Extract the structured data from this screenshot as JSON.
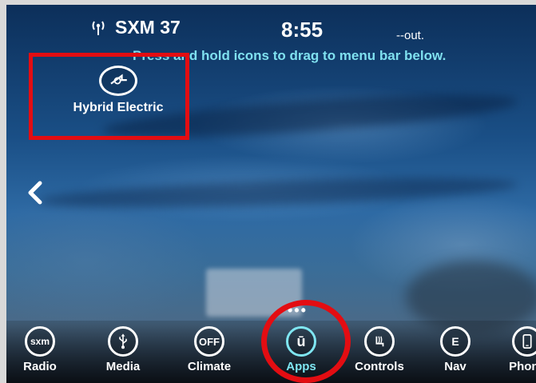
{
  "status": {
    "station": "SXM 37",
    "time": "8:55",
    "out_text": "--out."
  },
  "hint": "Press and hold icons to drag to menu bar below.",
  "apps": [
    {
      "label": "Hybrid Electric",
      "icon": "hybrid-electric-icon"
    }
  ],
  "dock": {
    "items": [
      {
        "label": "Radio",
        "icon": "sxm-icon",
        "icon_text": "sxm"
      },
      {
        "label": "Media",
        "icon": "usb-icon"
      },
      {
        "label": "Climate",
        "icon": "climate-off-icon",
        "icon_text": "OFF"
      },
      {
        "label": "Apps",
        "icon": "apps-icon",
        "icon_text": "ū",
        "active": true
      },
      {
        "label": "Controls",
        "icon": "seat-controls-icon"
      },
      {
        "label": "Nav",
        "icon": "compass-icon",
        "icon_text": "E"
      },
      {
        "label": "Phone",
        "icon": "phone-icon"
      }
    ],
    "more_indicator": "•••"
  },
  "colors": {
    "accent": "#7fe6f2",
    "hint_text": "#7fe0ef",
    "annotation": "#e30d12"
  }
}
